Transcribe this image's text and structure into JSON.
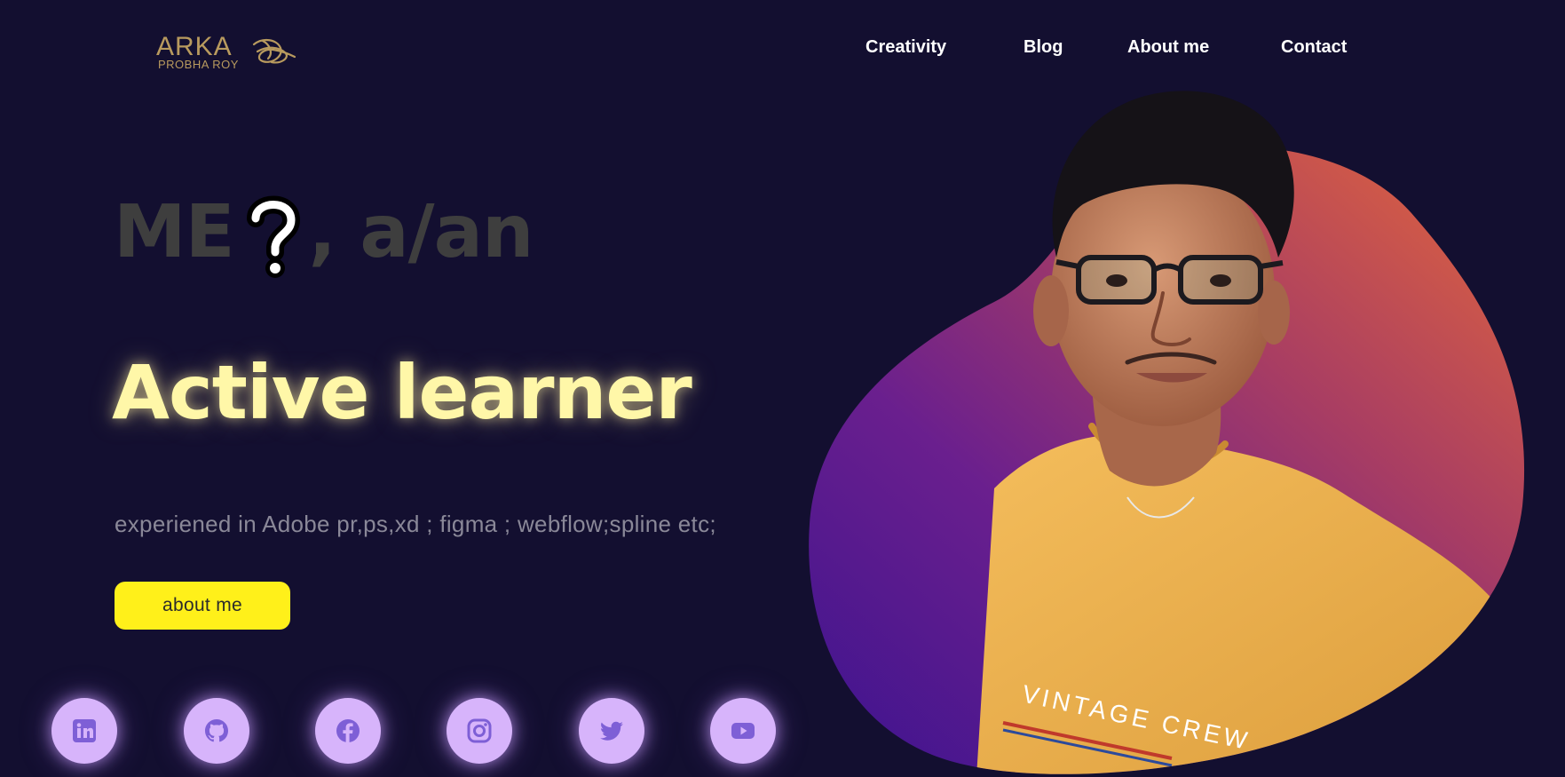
{
  "brand": {
    "name": "ARKA",
    "subtitle": "PROBHA ROY",
    "color": "#b89a5e"
  },
  "nav": {
    "items": [
      {
        "label": "Creativity"
      },
      {
        "label": "Blog"
      },
      {
        "label": "About me"
      },
      {
        "label": "Contact"
      }
    ]
  },
  "hero": {
    "intro_prefix": "ME",
    "intro_suffix": ", a/an",
    "role": "Active learner",
    "experience": "experiened in Adobe pr,ps,xd ; figma ; webflow;spline etc;",
    "cta_label": "about me"
  },
  "social": [
    {
      "icon": "linkedin-icon"
    },
    {
      "icon": "github-icon"
    },
    {
      "icon": "facebook-icon"
    },
    {
      "icon": "instagram-icon"
    },
    {
      "icon": "twitter-icon"
    },
    {
      "icon": "youtube-icon"
    }
  ],
  "portrait": {
    "shirt_text": "VINTAGE CREW"
  },
  "colors": {
    "background": "#130f30",
    "accent_yellow": "#fff01a",
    "role_text": "#fff7a8",
    "social_bg": "#d7b4fb",
    "social_icon": "#7e5fd6",
    "blob_start": "#4a17a3",
    "blob_end": "#e2623a"
  }
}
